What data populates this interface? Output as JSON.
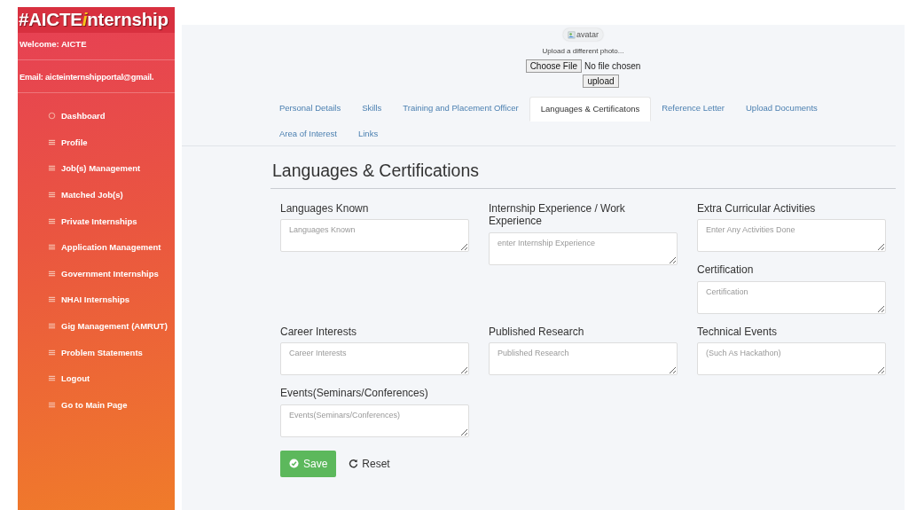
{
  "sidebar": {
    "logo": {
      "prefix": "#AICTE",
      "accent": "i",
      "suffix": "nternship"
    },
    "welcome": "Welcome: AICTE",
    "email": "Email: aicteinternshipportal@gmail.",
    "items": [
      {
        "kind": "circle",
        "label": "Dashboard"
      },
      {
        "kind": "list",
        "label": "Profile"
      },
      {
        "kind": "list",
        "label": "Job(s) Management"
      },
      {
        "kind": "list",
        "label": "Matched Job(s)"
      },
      {
        "kind": "list",
        "label": "Private Internships"
      },
      {
        "kind": "list",
        "label": "Application Management"
      },
      {
        "kind": "list",
        "label": "Government Internships"
      },
      {
        "kind": "list",
        "label": "NHAI Internships"
      },
      {
        "kind": "list",
        "label": "Gig Management (AMRUT)"
      },
      {
        "kind": "list",
        "label": "Problem Statements"
      },
      {
        "kind": "list",
        "label": "Logout"
      },
      {
        "kind": "list",
        "label": "Go to Main Page"
      }
    ]
  },
  "photo": {
    "alt": "avatar",
    "hint": "Upload a different photo...",
    "choose_button": "Choose File",
    "file_status": "No file chosen",
    "upload_button": "upload"
  },
  "tabs": [
    [
      {
        "label": "Personal Details",
        "selected": false
      },
      {
        "label": "Skills",
        "selected": false
      },
      {
        "label": "Training and Placement Officer",
        "selected": false
      },
      {
        "label": "Languages & Certificatons",
        "selected": true
      },
      {
        "label": "Reference Letter",
        "selected": false
      },
      {
        "label": "Upload Documents",
        "selected": false
      }
    ],
    [
      {
        "label": "Area of Interest",
        "selected": false
      },
      {
        "label": "Links",
        "selected": false
      }
    ]
  ],
  "form": {
    "title": "Languages & Certifications",
    "rows": [
      [
        [
          {
            "label": "Languages Known",
            "placeholder": "Languages Known"
          }
        ],
        [
          {
            "label": "Internship Experience / Work Experience",
            "placeholder": "enter Internship Experience"
          }
        ],
        [
          {
            "label": "Extra Curricular Activities",
            "placeholder": "Enter Any Activities Done"
          },
          {
            "label": "Certification",
            "placeholder": "Certification"
          }
        ]
      ],
      [
        [
          {
            "label": "Career Interests",
            "placeholder": "Career Interests"
          }
        ],
        [
          {
            "label": "Published Research",
            "placeholder": "Published Research"
          }
        ],
        [
          {
            "label": "Technical Events",
            "placeholder": "(Such As Hackathon)"
          }
        ]
      ],
      [
        [
          {
            "label": "Events(Seminars/Conferences)",
            "placeholder": "Events(Seminars/Conferences)"
          }
        ]
      ]
    ],
    "save_button": "Save",
    "reset_button": "Reset"
  }
}
